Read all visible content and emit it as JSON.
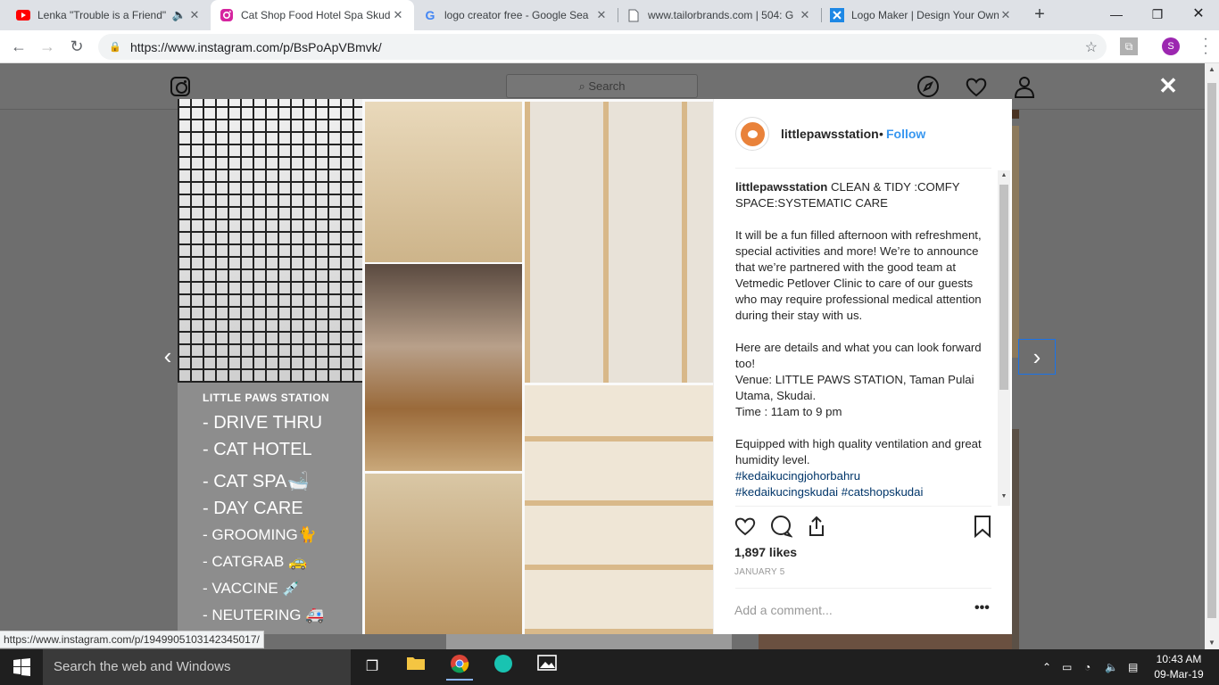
{
  "browser": {
    "tabs": [
      {
        "title": "Lenka \"Trouble is a Friend\"",
        "icon": "youtube-icon",
        "audio": true
      },
      {
        "title": "Cat Shop Food Hotel Spa Skud",
        "icon": "instagram-icon",
        "active": true
      },
      {
        "title": "logo creator free - Google Sea",
        "icon": "google-icon"
      },
      {
        "title": "www.tailorbrands.com | 504: G",
        "icon": "page-icon"
      },
      {
        "title": "Logo Maker | Design Your Own",
        "icon": "logomaker-icon"
      }
    ],
    "url": "https://www.instagram.com/p/BsPoApVBmvk/",
    "profile_initial": "S",
    "status_url": "https://www.instagram.com/p/1949905103142345017/"
  },
  "instagram": {
    "search_placeholder": "Search",
    "post": {
      "username": "littlepawsstation",
      "follow_label": "Follow",
      "dot": "•",
      "caption_title": "CLEAN & TIDY :COMFY SPACE:SYSTEMATIC CARE",
      "caption_lines": [
        "It will be a fun filled afternoon with refreshment, special activities and more! We’re to announce that we’re partnered with the good team at Vetmedic Petlover Clinic to care of our guests who may require professional medical attention during their stay with us.",
        "Here are details and what you can look forward too!",
        "Venue: LITTLE PAWS STATION, Taman Pulai Utama, Skudai.",
        "Time : 11am to 9 pm",
        "Equipped with high quality ventilation and great humidity level."
      ],
      "hashtags": [
        "#kedaikucingjohorbahru",
        "#kedaikucingskudai #catshopskudai"
      ],
      "likes": "1,897 likes",
      "date": "JANUARY 5",
      "comment_placeholder": "Add a comment...",
      "more_label": "•••",
      "image_panel": {
        "title": "LITTLE PAWS STATION",
        "items": [
          "- DRIVE THRU",
          "- CAT HOTEL",
          "- CAT SPA🛁",
          "- DAY CARE",
          "- GROOMING🐈",
          "- CATGRAB 🚕",
          "- VACCINE 💉",
          "- NEUTERING 🚑"
        ]
      }
    }
  },
  "taskbar": {
    "search_placeholder": "Search the web and Windows",
    "time": "10:43 AM",
    "date": "09-Mar-19"
  },
  "colors": {
    "accent": "#3897f0",
    "overlay": "#6e6e6e",
    "taskbar": "#1f1f1f"
  }
}
